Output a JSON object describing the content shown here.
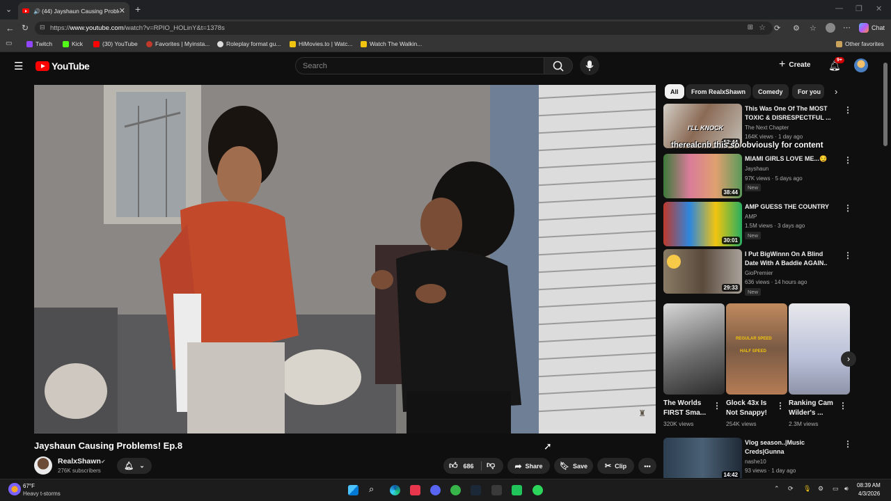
{
  "browser": {
    "tab_title": "(44) Jayshaun Causing Proble...",
    "url_prefix": "https://",
    "url_host": "www.youtube.com",
    "url_path": "/watch?v=RPIO_HOLinY&t=1378s",
    "chat_label": "Chat",
    "bookmarks": [
      "Twitch",
      "Kick",
      "(30) YouTube",
      "Favorites | Myinsta...",
      "Roleplay format gu...",
      "HiMovies.to | Watc...",
      "Watch The Walkin..."
    ],
    "other_favorites": "Other favorites"
  },
  "header": {
    "logo_text": "YouTube",
    "search_placeholder": "Search",
    "create_label": "Create",
    "notif_count": "9+"
  },
  "video": {
    "title": "Jayshaun Causing Problems! Ep.8",
    "channel": "RealxShawn",
    "subscribers": "276K subscribers",
    "likes": "686",
    "share": "Share",
    "save": "Save",
    "clip": "Clip"
  },
  "sidebar": {
    "chips": [
      "All",
      "From RealxShawn",
      "Comedy",
      "For you"
    ],
    "overlay_comment": "therealcnb  this so obviously for content",
    "recs": [
      {
        "title": "This Was One Of The MOST TOXIC & DISRESPECTFUL ...",
        "channel": "The Next Chapter",
        "meta": "164K views · 1 day ago",
        "duration": "52:44",
        "badge": ""
      },
      {
        "title": "MIAMI GIRLS LOVE ME...😏",
        "channel": "Jayshaun",
        "meta": "97K views · 5 days ago",
        "duration": "38:44",
        "badge": "New"
      },
      {
        "title": "AMP GUESS THE COUNTRY",
        "channel": "AMP",
        "meta": "1.5M views · 3 days ago",
        "duration": "30:01",
        "badge": "New"
      },
      {
        "title": "I Put BigWinnn On A Blind Date With A Baddie AGAIN..",
        "channel": "GioPremier",
        "meta": "636 views · 14 hours ago",
        "duration": "29:33",
        "badge": "New"
      },
      {
        "title": "Vlog season..|Music Creds|Gunna",
        "channel": "nashe10",
        "meta": "93 views · 1 day ago",
        "duration": "14:42",
        "badge": ""
      }
    ],
    "shorts": [
      {
        "title": "The Worlds FIRST Sma...",
        "views": "320K views"
      },
      {
        "title": "Glock 43x Is Not Snappy!",
        "views": "254K views"
      },
      {
        "title": "Ranking Cam Wilder's ...",
        "views": "2.3M views"
      }
    ],
    "short_captions": [
      "REGULAR SPEED",
      "HALF SPEED"
    ]
  },
  "taskbar": {
    "temp": "67°F",
    "weather": "Heavy t-storms",
    "time": "08:39 AM",
    "date": "4/3/2026"
  }
}
